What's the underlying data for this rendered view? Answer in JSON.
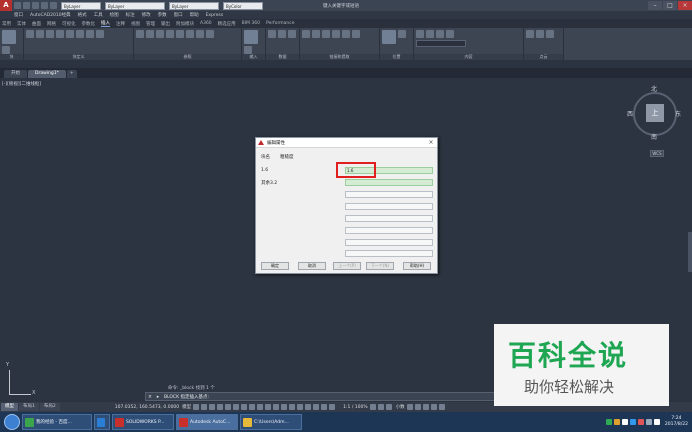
{
  "titlebar": {
    "app_icon": "A",
    "layer1": "ByLayer",
    "layer2": "ByLayer",
    "layer3": "ByLayer",
    "color": "ByColor",
    "window_title": "键入关键字或短语",
    "minimize": "–",
    "maximize": "□",
    "close": "×"
  },
  "menubar": [
    "窗口",
    "AutoCAD2010经典",
    "格式",
    "工具",
    "绘图",
    "标注",
    "修改",
    "参数",
    "窗口",
    "帮助",
    "Express"
  ],
  "ribbon_tabs": [
    {
      "label": "常用",
      "active": false
    },
    {
      "label": "实体",
      "active": false
    },
    {
      "label": "曲面",
      "active": false
    },
    {
      "label": "网格",
      "active": false
    },
    {
      "label": "可视化",
      "active": false
    },
    {
      "label": "参数化",
      "active": false
    },
    {
      "label": "插入",
      "active": true
    },
    {
      "label": "注释",
      "active": false
    },
    {
      "label": "视图",
      "active": false
    },
    {
      "label": "管理",
      "active": false
    },
    {
      "label": "输出",
      "active": false
    },
    {
      "label": "附加模块",
      "active": false
    },
    {
      "label": "A360",
      "active": false
    },
    {
      "label": "精选应用",
      "active": false
    },
    {
      "label": "BIM 360",
      "active": false
    },
    {
      "label": "Performance",
      "active": false
    }
  ],
  "ribbon_panels": [
    "块",
    "块定义",
    "参照",
    "输入",
    "数据",
    "链接和提取",
    "位置",
    "内容",
    "点云"
  ],
  "doc_tabs": [
    {
      "label": "开始",
      "active": false
    },
    {
      "label": "Drawing1*",
      "active": true
    },
    {
      "label": "+",
      "active": false
    }
  ],
  "view_label": "[-][俯视][二维线框]",
  "viewcube": {
    "north": "北",
    "south": "南",
    "west": "西",
    "east": "东",
    "top": "上",
    "wcs": "WCS"
  },
  "ucs": {
    "x": "X",
    "y": "Y"
  },
  "dialog": {
    "title": "编辑属性",
    "close": "×",
    "block_name_label": "块名",
    "block_name_value": "粗糙度",
    "attr1_label": "1.6",
    "attr1_value": "1.6",
    "attr2_label": "其余3.2",
    "buttons": {
      "ok": "确定",
      "cancel": "取消",
      "prev": "上一个(P)",
      "next": "下一个(N)",
      "help": "帮助(H)"
    }
  },
  "command": {
    "history": "命令: _block 找到 1 个",
    "line": "BLOCK 指定插入基点:",
    "close": "×",
    "icon": "▸"
  },
  "status": {
    "layout_tabs": [
      {
        "label": "模型",
        "active": true
      },
      {
        "label": "布局1",
        "active": false
      },
      {
        "label": "布局2",
        "active": false
      }
    ],
    "coords": "107.0352, 160.5473, 0.0000",
    "model": "模型",
    "scale": "1:1 / 100%",
    "unit": "小数"
  },
  "taskbar": {
    "items": [
      {
        "label": "我的经验 - 百度...",
        "color": "#3aa54a",
        "active": false
      },
      {
        "label": "",
        "color": "#2a7fd4",
        "active": false
      },
      {
        "label": "SOLIDWORKS P...",
        "color": "#c8302c",
        "active": false
      },
      {
        "label": "Autodesk AutoC...",
        "color": "#c8302c",
        "active": true
      },
      {
        "label": "C:\\Users\\Adm...",
        "color": "#e6b93a",
        "active": false
      }
    ],
    "time": "7:24",
    "date": "2017/8/22"
  },
  "watermark": {
    "main": "百科全说",
    "sub": "助你轻松解决"
  },
  "colors": {
    "accent_red": "#e02020",
    "field_green": "#d4ecd4",
    "watermark_green": "#1ea653"
  }
}
